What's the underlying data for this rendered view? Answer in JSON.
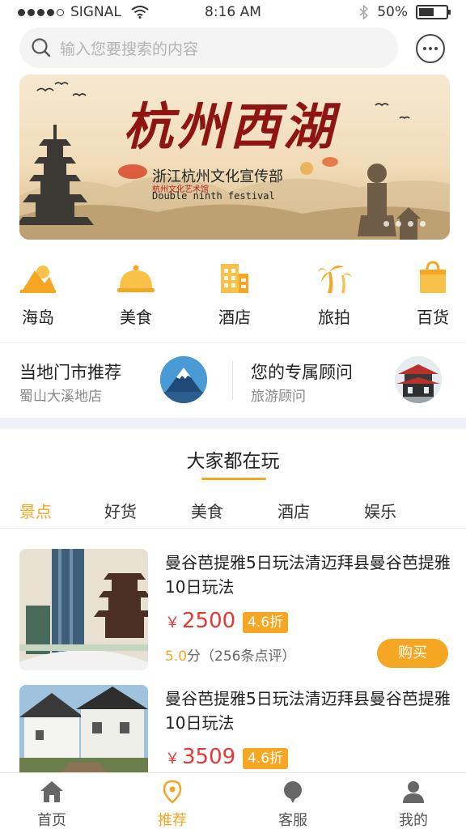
{
  "status_bar": {
    "carrier": "SIGNAL",
    "time": "8:16 AM",
    "battery": "50%"
  },
  "search": {
    "placeholder": "输入您要搜索的内容"
  },
  "banner": {
    "title": "杭州西湖",
    "subtitle": "浙江杭州文化宣传部",
    "tag": "杭州文化艺术馆",
    "english": "Double ninth festival",
    "page_count": 4
  },
  "categories": [
    {
      "label": "海岛",
      "icon": "island-icon"
    },
    {
      "label": "美食",
      "icon": "food-cloche-icon"
    },
    {
      "label": "酒店",
      "icon": "hotel-building-icon"
    },
    {
      "label": "旅拍",
      "icon": "palm-tree-icon"
    },
    {
      "label": "百货",
      "icon": "shopping-bag-icon"
    }
  ],
  "recommend": {
    "store": {
      "title": "当地门市推荐",
      "subtitle": "蜀山大溪地店",
      "avatar": "mountain-avatar"
    },
    "advisor": {
      "title": "您的专属顾问",
      "subtitle": "旅游顾问",
      "avatar": "pagoda-avatar"
    }
  },
  "hot": {
    "title": "大家都在玩",
    "tabs": [
      "景点",
      "好货",
      "美食",
      "酒店",
      "娱乐"
    ],
    "active_tab": "景点"
  },
  "products": [
    {
      "title": "曼谷芭提雅5日玩法清迈拜县曼谷芭提雅10日玩法",
      "currency": "￥",
      "price": "2500",
      "discount": "4.6折",
      "score": "5.0",
      "score_unit": "分",
      "reviews": "（256条点评）",
      "buy_label": "购买"
    },
    {
      "title": "曼谷芭提雅5日玩法清迈拜县曼谷芭提雅10日玩法",
      "currency": "￥",
      "price": "3509",
      "discount": "4.6折"
    }
  ],
  "tabbar": [
    {
      "label": "首页",
      "icon": "home-icon"
    },
    {
      "label": "推荐",
      "icon": "location-pin-icon",
      "active": true
    },
    {
      "label": "客服",
      "icon": "chat-bubble-icon"
    },
    {
      "label": "我的",
      "icon": "user-icon"
    }
  ],
  "colors": {
    "accent": "#f5a623",
    "price": "#e53935",
    "banner_title": "#8e1512"
  }
}
